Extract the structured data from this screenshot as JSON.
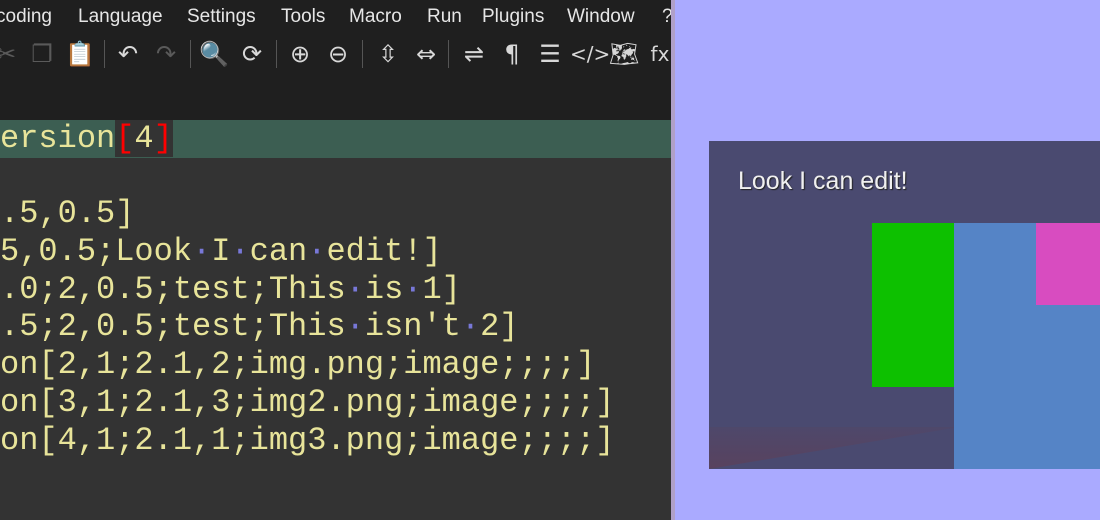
{
  "menu": [
    "coding",
    "Language",
    "Settings",
    "Tools",
    "Macro",
    "Run",
    "Plugins",
    "Window",
    "?"
  ],
  "toolbar": [
    {
      "icon": "cut-icon",
      "glyph": "✂",
      "disabled": true
    },
    {
      "icon": "copy-icon",
      "glyph": "❐",
      "disabled": true
    },
    {
      "icon": "paste-icon",
      "glyph": "📋",
      "disabled": true
    },
    {
      "icon": "undo-icon",
      "glyph": "↶",
      "disabled": false
    },
    {
      "icon": "redo-icon",
      "glyph": "↷",
      "disabled": true
    },
    {
      "icon": "find-icon",
      "glyph": "🔍",
      "disabled": false
    },
    {
      "icon": "replace-icon",
      "glyph": "⟳",
      "disabled": false
    },
    {
      "icon": "zoom-in-icon",
      "glyph": "⊕",
      "disabled": false
    },
    {
      "icon": "zoom-out-icon",
      "glyph": "⊖",
      "disabled": false
    },
    {
      "icon": "sync-vertical-icon",
      "glyph": "⇳",
      "disabled": false
    },
    {
      "icon": "sync-horizontal-icon",
      "glyph": "⇔",
      "disabled": false
    },
    {
      "icon": "word-wrap-icon",
      "glyph": "⇌",
      "disabled": false
    },
    {
      "icon": "show-all-characters-icon",
      "glyph": "¶",
      "disabled": false
    },
    {
      "icon": "indent-guide-icon",
      "glyph": "☰",
      "disabled": false
    },
    {
      "icon": "xml-tag-icon",
      "glyph": "</>",
      "disabled": false
    },
    {
      "icon": "document-map-icon",
      "glyph": "🗺",
      "disabled": false
    },
    {
      "icon": "function-list-icon",
      "glyph": "fx",
      "disabled": false
    }
  ],
  "code": {
    "current_line": {
      "prefix": "ersion",
      "open": "[",
      "inner": "4",
      "close": "]"
    },
    "lines": [
      "",
      ".5,0.5]",
      "5,0.5;Look I can edit!]",
      ".0;2,0.5;test;This is 1]",
      ".5;2,0.5;test;This isn't 2]",
      "on[2,1;2.1,2;img.png;image;;;;]",
      "on[3,1;2.1,3;img2.png;image;;;;]",
      "on[4,1;2.1,1;img3.png;image;;;;]"
    ]
  },
  "preview": {
    "label": "Look I can edit!",
    "colors": {
      "background": "#aaaaff",
      "panel": "#4a4a70",
      "green": "#0dc000",
      "blue": "#5584c6",
      "pink": "#d84cc0"
    }
  }
}
